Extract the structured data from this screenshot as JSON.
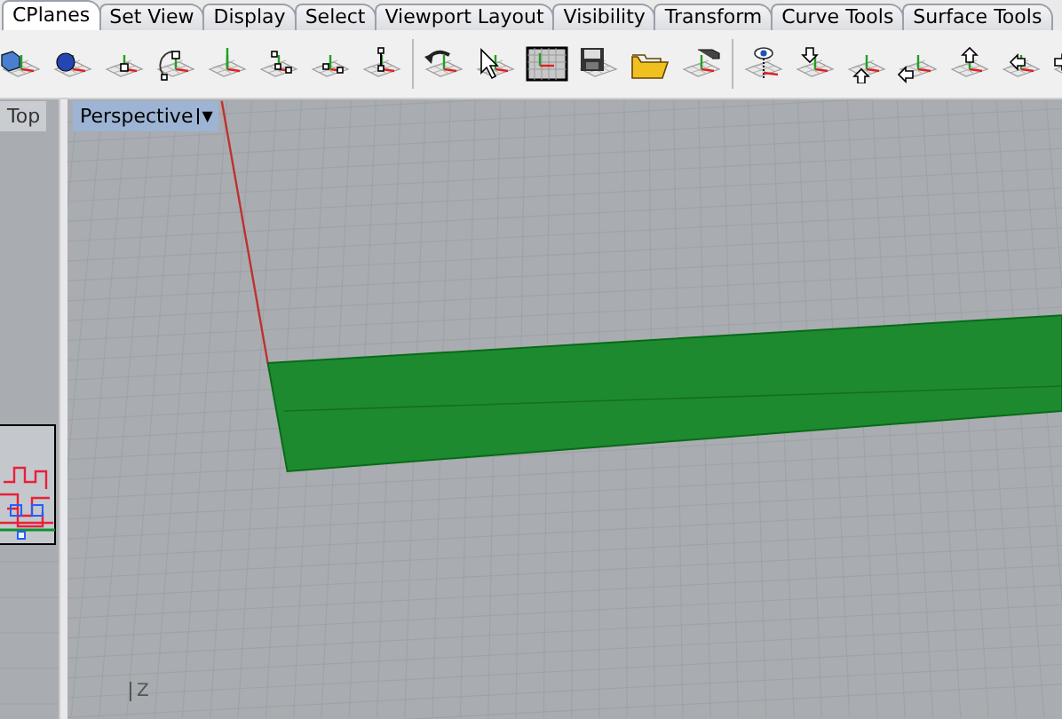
{
  "tabs": [
    {
      "label": "CPlanes",
      "selected": true
    },
    {
      "label": "Set View",
      "selected": false
    },
    {
      "label": "Display",
      "selected": false
    },
    {
      "label": "Select",
      "selected": false
    },
    {
      "label": "Viewport Layout",
      "selected": false
    },
    {
      "label": "Visibility",
      "selected": false
    },
    {
      "label": "Transform",
      "selected": false
    },
    {
      "label": "Curve Tools",
      "selected": false
    },
    {
      "label": "Surface Tools",
      "selected": false
    }
  ],
  "viewports": [
    {
      "title": "Top",
      "active": false
    },
    {
      "title": "Perspective",
      "active": true,
      "menu_arrow": "▼",
      "axis_label": "Z"
    }
  ]
}
